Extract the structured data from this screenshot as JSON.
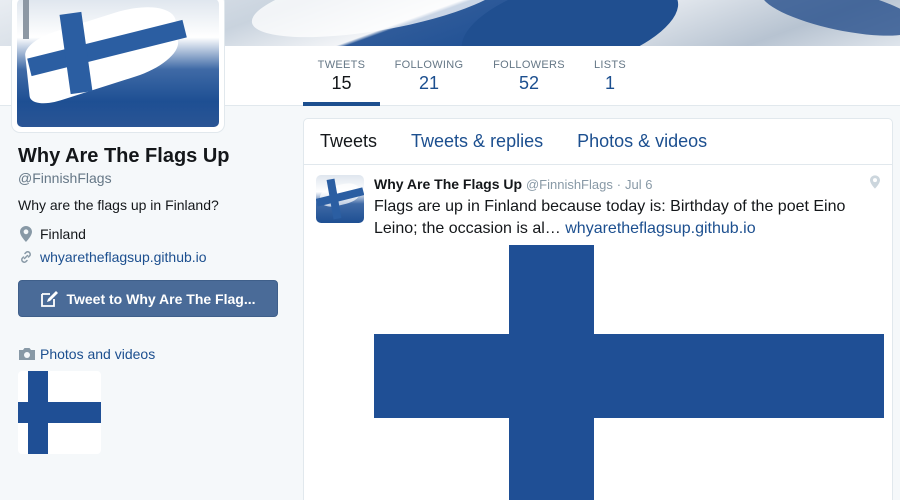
{
  "profile": {
    "name": "Why Are The Flags Up",
    "handle": "@FinnishFlags",
    "bio": "Why are the flags up in Finland?",
    "location": "Finland",
    "url": "whyaretheflagsup.github.io",
    "tweet_to_label": "Tweet to Why Are The Flag...",
    "photos_videos_label": "Photos and videos"
  },
  "stats": [
    {
      "label": "TWEETS",
      "value": "15",
      "active": true
    },
    {
      "label": "FOLLOWING",
      "value": "21",
      "active": false
    },
    {
      "label": "FOLLOWERS",
      "value": "52",
      "active": false
    },
    {
      "label": "LISTS",
      "value": "1",
      "active": false
    }
  ],
  "timeline": {
    "tabs": [
      {
        "label": "Tweets",
        "active": true
      },
      {
        "label": "Tweets & replies",
        "active": false
      },
      {
        "label": "Photos & videos",
        "active": false
      }
    ]
  },
  "tweet": {
    "name": "Why Are The Flags Up",
    "handle": "@FinnishFlags",
    "separator": "·",
    "date": "Jul 6",
    "text": "Flags are up in Finland because today is: Birthday of the poet Eino Leino; the occasion is al…",
    "link": "whyaretheflagsup.github.io"
  },
  "colors": {
    "link": "#1c4f8f",
    "flag_blue": "#1f4f95",
    "button": "#4a6b98"
  },
  "icons": {
    "location": "map-pin-icon",
    "url": "link-icon",
    "tweet_to": "compose-icon",
    "photos": "camera-icon",
    "geo": "geo-pin-icon"
  }
}
